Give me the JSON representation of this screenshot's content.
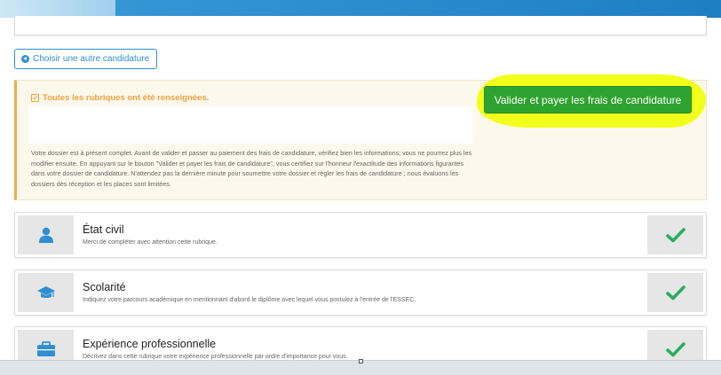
{
  "header": {
    "banner": "",
    "card": ""
  },
  "choose_button": {
    "label": "Choisir une autre candidature",
    "icon": "arrow-circle-left-icon"
  },
  "notice": {
    "title": "Toutes les rubriques ont été renseignées.",
    "title_icon": "check-square-icon",
    "text": "Votre dossier est à présent complet. Avant de valider et passer au paiement des frais de candidature, vérifiez bien les informations; vous ne pourrez plus les modifier ensuite. En appuyant sur le bouton \"Valider et payer les frais de candidature\", vous certifiez sur l'honneur l'exactitude des informations figurantes dans votre dossier de candidature. N'attendez pas la dernière minute pour soumettre votre dossier et régler les frais de candidature ; nous évaluons les dossiers dès réception et les places sont limitées."
  },
  "validate_button": {
    "label": "Valider et payer les frais de candidature"
  },
  "sections": [
    {
      "title": "État civil",
      "description": "Merci de compléter avec attention cette rubrique.",
      "icon": "user-icon",
      "status_icon": "checkmark-icon"
    },
    {
      "title": "Scolarité",
      "description": "Indiquez votre parcours académique en mentionnant d'abord le diplôme avec lequel vous postulez à l'entrée de l'ESSEC.",
      "icon": "graduation-cap-icon",
      "status_icon": "checkmark-icon"
    },
    {
      "title": "Expérience professionnelle",
      "description": "Décrivez dans cette rubrique votre expérience professionnelle par ordre d'importance pour vous.",
      "icon": "briefcase-icon",
      "status_icon": "checkmark-icon"
    }
  ],
  "colors": {
    "accent": "#2f8fd0",
    "warning": "#f0ad4e",
    "success": "#2fa32f",
    "check": "#27ae60",
    "highlight": "#f2ff1a"
  }
}
